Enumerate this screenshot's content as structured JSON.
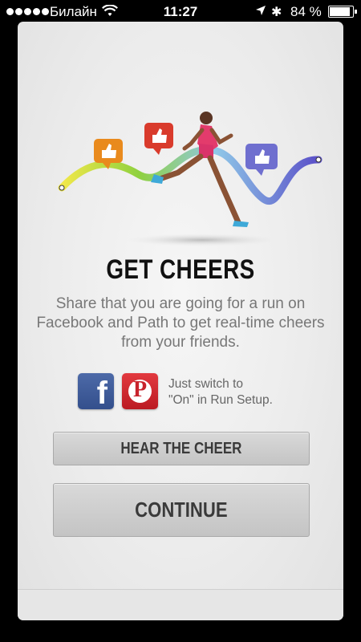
{
  "status_bar": {
    "carrier": "Билайн",
    "time": "11:27",
    "battery_text": "84 %",
    "battery_level": 0.84
  },
  "screen": {
    "title": "GET CHEERS",
    "description": "Share that you are going for a run on Facebook and Path to get real-time cheers from your friends.",
    "hint_line1": "Just switch to",
    "hint_line2": "\"On\" in Run Setup.",
    "hear_button": "HEAR THE CHEER",
    "continue_button": "CONTINUE"
  },
  "icons": {
    "facebook": "facebook-icon",
    "pinterest": "pinterest-icon",
    "thumbs_up": "thumbs-up-icon"
  },
  "colors": {
    "facebook": "#3b5998",
    "pinterest": "#cb2027",
    "cheer_orange": "#e98a1d",
    "cheer_red": "#d93b2c",
    "cheer_purple": "#6f6fcf"
  }
}
